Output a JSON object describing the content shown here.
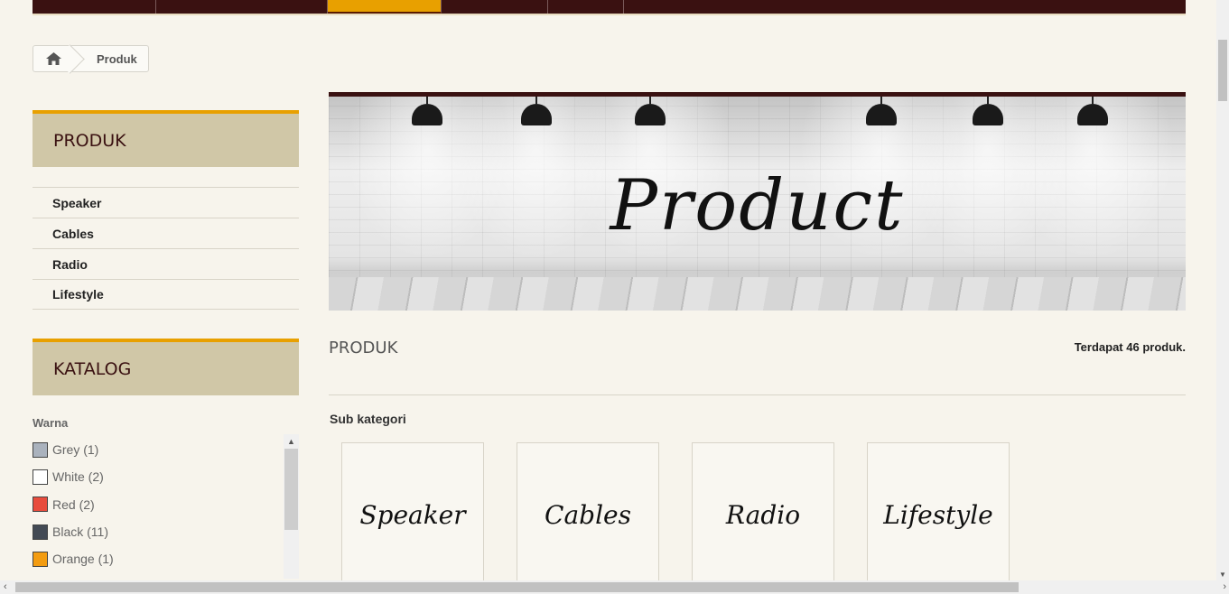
{
  "breadcrumb": {
    "current": "Produk"
  },
  "sidebar": {
    "produk_title": "PRODUK",
    "categories": [
      "Speaker",
      "Cables",
      "Radio",
      "Lifestyle"
    ],
    "katalog_title": "KATALOG",
    "filter_label": "Warna",
    "colors": [
      {
        "label": "Grey (1)",
        "swatch": "#aab2bd"
      },
      {
        "label": "White (2)",
        "swatch": "#ffffff"
      },
      {
        "label": "Red (2)",
        "swatch": "#e84c3d"
      },
      {
        "label": "Black (11)",
        "swatch": "#434a54"
      },
      {
        "label": "Orange (1)",
        "swatch": "#f39c11"
      },
      {
        "label": "",
        "swatch": "#5d9cec"
      }
    ]
  },
  "banner": {
    "word": "Product"
  },
  "main": {
    "heading": "PRODUK",
    "count": "Terdapat 46 produk.",
    "subcat_label": "Sub kategori",
    "subcats": [
      "Speaker",
      "Cables",
      "Radio",
      "Lifestyle"
    ]
  },
  "colors": {
    "nav_bg": "#3a1111",
    "accent": "#e8a000",
    "block_bg": "#d0c7a7"
  }
}
